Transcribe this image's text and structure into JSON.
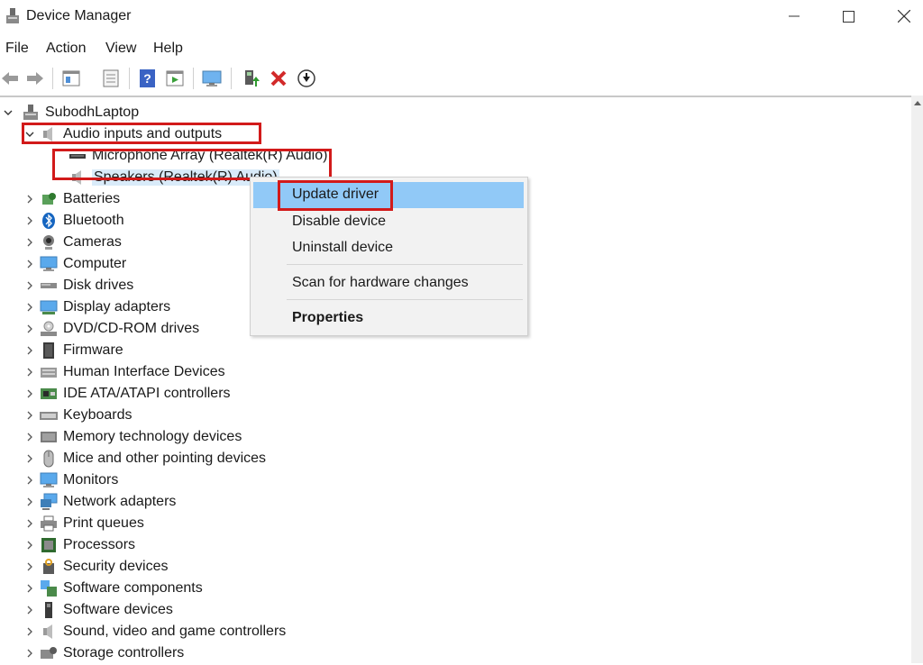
{
  "window": {
    "title": "Device Manager"
  },
  "menu": [
    "File",
    "Action",
    "View",
    "Help"
  ],
  "toolbar": [
    "back-icon",
    "forward-icon",
    "properties-icon",
    "show-hide-tree-icon",
    "help-icon",
    "action-pane-icon",
    "monitor-icon",
    "update-driver-icon",
    "uninstall-icon",
    "download-icon"
  ],
  "tree": {
    "root": "SubodhLaptop",
    "expanded_category": "Audio inputs and outputs",
    "children": [
      "Microphone Array (Realtek(R) Audio)",
      "Speakers (Realtek(R) Audio)"
    ],
    "categories": [
      "Batteries",
      "Bluetooth",
      "Cameras",
      "Computer",
      "Disk drives",
      "Display adapters",
      "DVD/CD-ROM drives",
      "Firmware",
      "Human Interface Devices",
      "IDE ATA/ATAPI controllers",
      "Keyboards",
      "Memory technology devices",
      "Mice and other pointing devices",
      "Monitors",
      "Network adapters",
      "Print queues",
      "Processors",
      "Security devices",
      "Software components",
      "Software devices",
      "Sound, video and game controllers",
      "Storage controllers"
    ]
  },
  "context_menu": {
    "update": "Update driver",
    "disable": "Disable device",
    "uninstall": "Uninstall device",
    "scan": "Scan for hardware changes",
    "properties": "Properties"
  },
  "colors": {
    "highlight": "#91c9f7",
    "annotation": "#d21a1a"
  }
}
